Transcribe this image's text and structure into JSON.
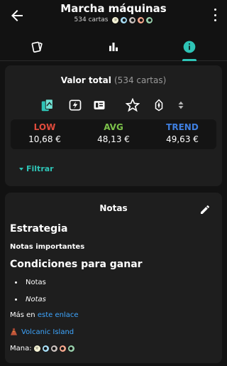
{
  "header": {
    "title": "Marcha máquinas",
    "card_count": "534 cartas"
  },
  "tabs": [
    {
      "icon": "cards-icon",
      "active": false
    },
    {
      "icon": "bar-chart-icon",
      "active": false
    },
    {
      "icon": "info-icon",
      "active": true
    }
  ],
  "value_card": {
    "title": "Valor total",
    "count": "(534 cartas)",
    "icons": [
      "cards-stack-icon",
      "lightning-card-icon",
      "price-card-icon",
      "castle-icon",
      "star-icon",
      "crystal-icon",
      "sort-icon"
    ],
    "prices": [
      {
        "label": "LOW",
        "value": "10,68 €",
        "color": "#e04b3c"
      },
      {
        "label": "AVG",
        "value": "48,13 €",
        "color": "#7cc24a"
      },
      {
        "label": "TREND",
        "value": "49,63 €",
        "color": "#3f7fe0"
      }
    ],
    "filter_label": "Filtrar"
  },
  "notes": {
    "title": "Notas",
    "heading1": "Estrategia",
    "bold1": "Notas importantes",
    "heading2": "Condiciones para ganar",
    "list": [
      "Notas",
      "Notas"
    ],
    "more_prefix": "Más en",
    "more_link": "este enlace",
    "card_link": "Volcanic Island",
    "mana_label": "Mana:"
  },
  "mana_colors": [
    "#f8f6d8",
    "#a9e0f9",
    "#cbc2bf",
    "#f9aa8f",
    "#9bd3ae"
  ],
  "accent": "#2ec4b6"
}
